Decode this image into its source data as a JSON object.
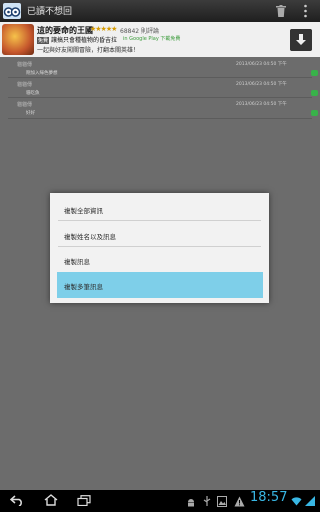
{
  "app": {
    "title": "已讀不想回"
  },
  "ad": {
    "title": "這的要命的王國",
    "stars": "★★★★★",
    "rating": "68842 則評論",
    "badge": "免費",
    "desc": "讓搞只會種植物的昏吉拉",
    "source": "in Google Play 下載免費",
    "tagline": "一起與好友闖關冒險，打翻本關英雄！"
  },
  "messages": [
    {
      "name": "貓貓傳",
      "date": "2013/06/23   04:50 下午",
      "text": "剛加入綠色夢想"
    },
    {
      "name": "貓貓傳",
      "date": "2013/06/23   04:50 下午",
      "text": "貓吃魚"
    },
    {
      "name": "貓貓傳",
      "date": "2013/06/23   04:50 下午",
      "text": "好好"
    }
  ],
  "dialog": {
    "options": [
      "複製全部資訊",
      "複製姓名以及訊息",
      "複製訊息",
      "複製多筆訊息"
    ],
    "selected_index": 3
  },
  "status": {
    "time": "18:57"
  },
  "colors": {
    "accent": "#39b7e4",
    "selection": "#7ecfe9",
    "badge": "#38b24a"
  }
}
